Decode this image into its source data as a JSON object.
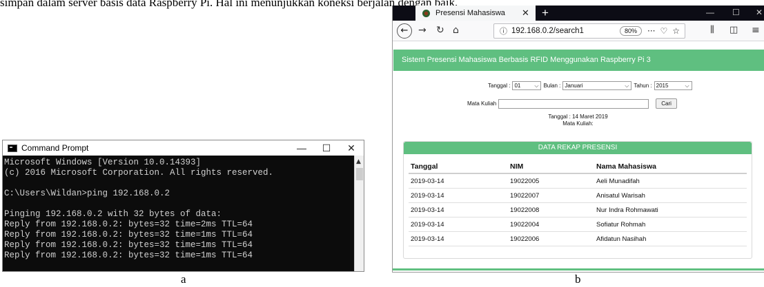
{
  "top_text": "simpan dalam server basis data Raspberry Pi. Hal ini menunjukkan koneksi berjalan dengan baik.",
  "cmd": {
    "title": "Command Prompt",
    "minimize": "—",
    "maximize": "☐",
    "close": "✕",
    "lines": "Microsoft Windows [Version 10.0.14393]\n(c) 2016 Microsoft Corporation. All rights reserved.\n\nC:\\Users\\Wildan>ping 192.168.0.2\n\nPinging 192.168.0.2 with 32 bytes of data:\nReply from 192.168.0.2: bytes=32 time=2ms TTL=64\nReply from 192.168.0.2: bytes=32 time=1ms TTL=64\nReply from 192.168.0.2: bytes=32 time=1ms TTL=64\nReply from 192.168.0.2: bytes=32 time=1ms TTL=64"
  },
  "captions": {
    "a": "a",
    "b": "b"
  },
  "browser": {
    "tab_title": "Presensi Mahasiswa",
    "tab_close": "✕",
    "new_tab": "+",
    "url": "192.168.0.2/search1",
    "zoom": "80%",
    "page_actions": "···",
    "app_title": "Sistem Presensi Mahasiswa Berbasis RFID Menggunakan Raspberry Pi 3"
  },
  "form": {
    "tanggal_label": "Tanggal :",
    "tanggal_value": "01",
    "bulan_label": "Bulan :",
    "bulan_value": "Januari",
    "tahun_label": "Tahun :",
    "tahun_value": "2015",
    "mata_kuliah_label": "Mata Kuliah",
    "mata_kuliah_value": "",
    "search_button": "Cari",
    "info_tanggal": "Tanggal : 14 Maret 2019",
    "info_matkul": "Mata Kuliah:"
  },
  "table": {
    "header": "DATA REKAP PRESENSI",
    "columns": [
      "Tanggal",
      "NIM",
      "Nama Mahasiswa"
    ],
    "rows": [
      [
        "2019-03-14",
        "19022005",
        "Aeli Munadifah"
      ],
      [
        "2019-03-14",
        "19022007",
        "Anisatul Warisah"
      ],
      [
        "2019-03-14",
        "19022008",
        "Nur Indra Rohmawati"
      ],
      [
        "2019-03-14",
        "19022004",
        "Sofiatur Rohmah"
      ],
      [
        "2019-03-14",
        "19022006",
        "Afidatun Nasihah"
      ]
    ]
  },
  "colors": {
    "accent_green": "#5fbf80",
    "terminal_bg": "#0c0c0c",
    "tabbar_bg": "#0c0c15"
  }
}
